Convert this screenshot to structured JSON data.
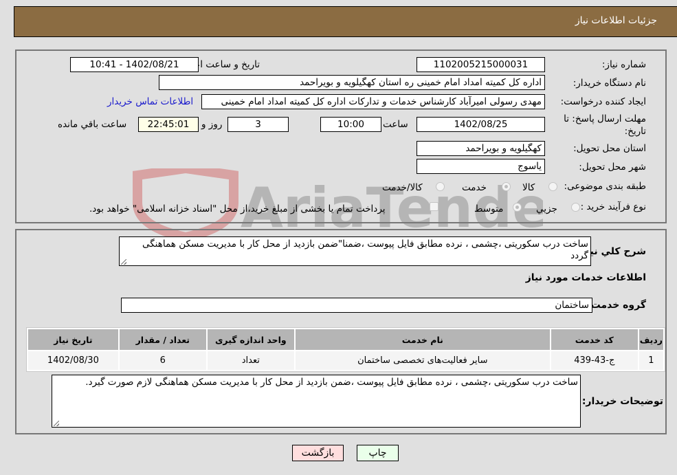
{
  "header": {
    "title": "جزئیات اطلاعات نیاز"
  },
  "form": {
    "need_number": {
      "label": "شماره نیاز:",
      "value": "1102005215000031"
    },
    "announce_datetime": {
      "label": "تاریخ و ساعت اعلان عمومي:",
      "value": "1402/08/21 - 10:41"
    },
    "buyer_org": {
      "label": "نام دستگاه خریدار:",
      "value": "اداره کل کمیته امداد امام خمینی  ره  استان کهگیلویه و بویراحمد"
    },
    "requester": {
      "label": "ایجاد کننده درخواست:",
      "value": "مهدی رسولی امیرآباد کارشناس خدمات و تدارکات اداره کل کمیته امداد امام خمینی",
      "contact_link": "اطلاعات تماس خریدار"
    },
    "deadline": {
      "label": "مهلت ارسال پاسخ: تا تاریخ:",
      "date": "1402/08/25",
      "time_label": "ساعت",
      "time": "10:00",
      "days": "3",
      "days_label": "روز و",
      "remaining": "22:45:01",
      "remaining_label": "ساعت باقي مانده"
    },
    "province": {
      "label": "استان محل تحویل:",
      "value": "کهگیلویه و بویراحمد"
    },
    "city": {
      "label": "شهر محل تحویل:",
      "value": "یاسوج"
    },
    "category": {
      "label": "طبقه بندی موضوعی:",
      "options": [
        "کالا",
        "خدمت",
        "کالا/خدمت"
      ],
      "selected": "خدمت"
    },
    "purchase_type": {
      "label": "نوع فرآیند خرید :",
      "options": [
        "جزيي",
        "متوسط"
      ],
      "selected": "متوسط",
      "treasury_note": "پرداخت تمام یا بخشی از مبلغ خرید،از محل \"اسناد خزانه اسلامی\" خواهد بود."
    }
  },
  "description": {
    "label": "شرح كلي نياز:",
    "value": "ساخت درب سکوریتی ،چشمی ، نرده مطابق فایل پیوست ،ضمنا\"ضمن بازدید از محل کار با مدیریت مسکن هماهنگی گردد"
  },
  "services": {
    "section_title": "اطلاعات خدمات مورد نیاز",
    "group_label": "گروه خدمت:",
    "group_value": "ساختمان",
    "columns": [
      "ردیف",
      "کد خدمت",
      "نام خدمت",
      "واحد اندازه گیری",
      "تعداد / مقدار",
      "تاریخ نیاز"
    ],
    "rows": [
      [
        "1",
        "ج-43-439",
        "سایر فعالیت‌های تخصصی ساختمان",
        "تعداد",
        "6",
        "1402/08/30"
      ]
    ]
  },
  "buyer_notes": {
    "label": "توضیحات خریدار:",
    "value": "ساخت درب سکوریتی ،چشمی ، نرده مطابق فایل پیوست ،ضمن بازدید از محل کار با مدیریت مسکن هماهنگی  لازم صورت گیرد."
  },
  "buttons": {
    "print": "چاپ",
    "back": "بازگشت"
  },
  "watermark": {
    "text": "AriaTender.neT"
  },
  "colors": {
    "header": "#8b6c42",
    "print_bg": "#eaffea",
    "back_bg": "#ffdede",
    "link": "#1a1acc"
  }
}
